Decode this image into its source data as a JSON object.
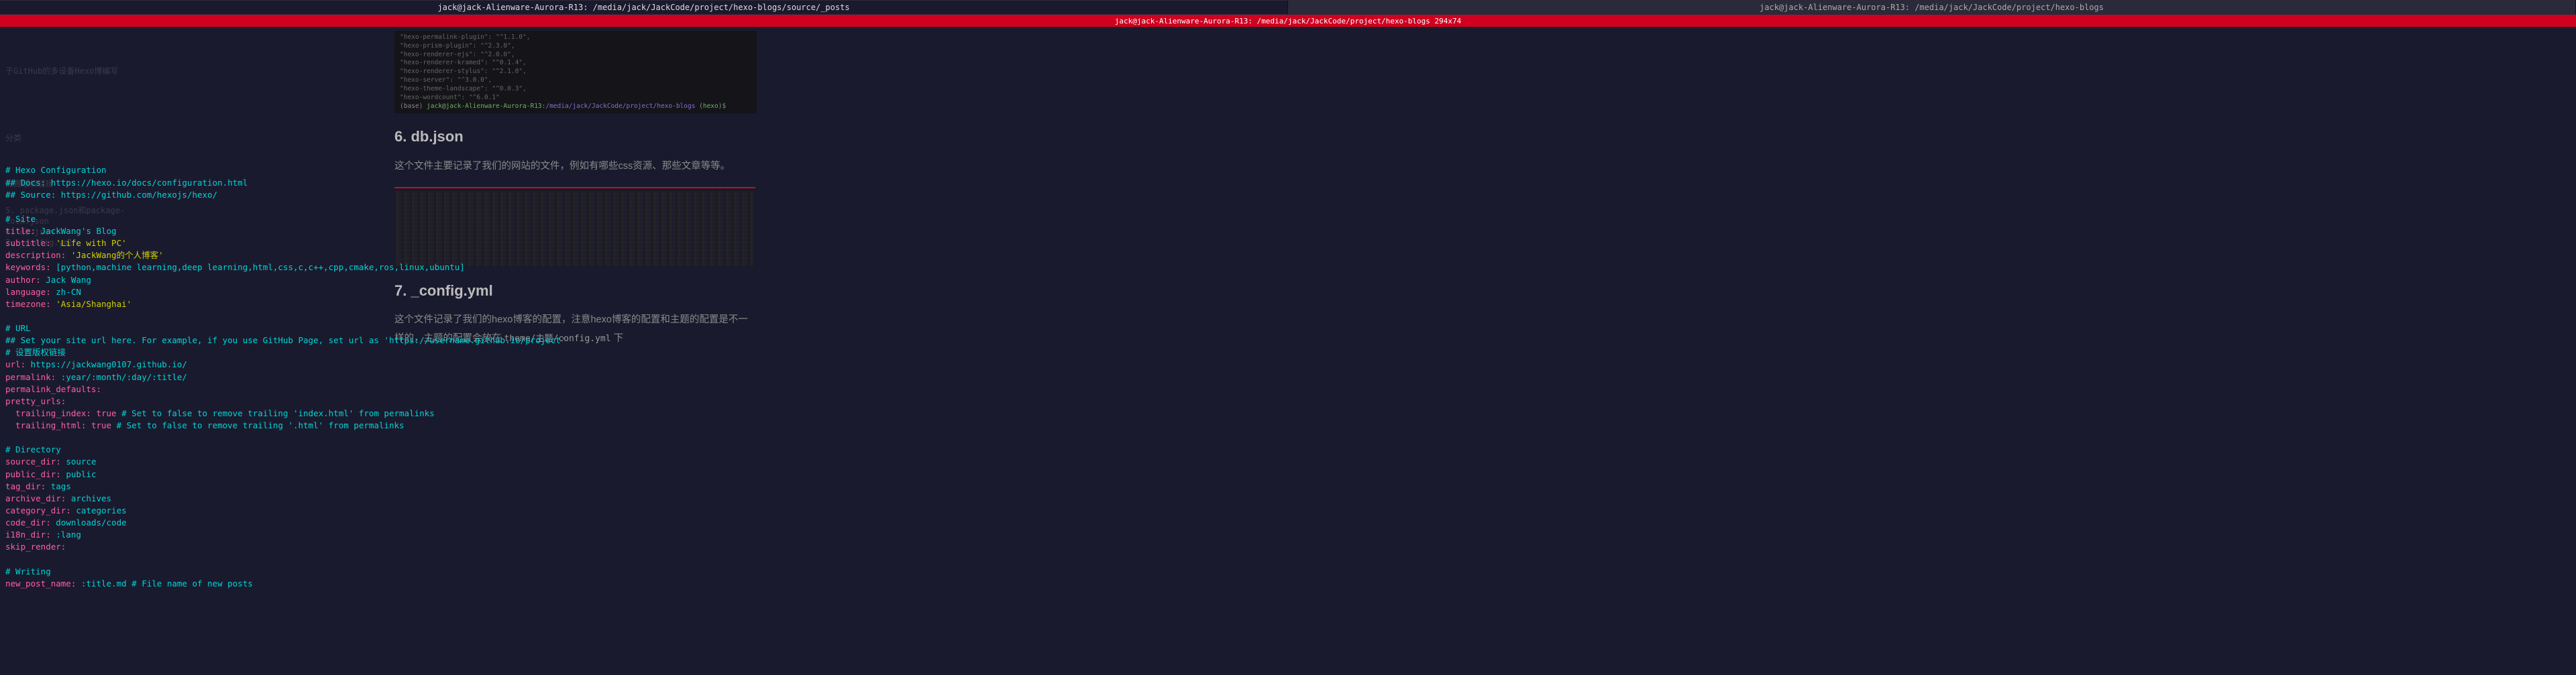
{
  "tabs": {
    "left": "jack@jack-Alienware-Aurora-R13: /media/jack/JackCode/project/hexo-blogs/source/_posts",
    "right": "jack@jack-Alienware-Aurora-R13: /media/jack/JackCode/project/hexo-blogs"
  },
  "subtab": "jack@jack-Alienware-Aurora-R13: /media/jack/JackCode/project/hexo-blogs 294x74",
  "ghost_nav": {
    "g1": "于GitHub的多设备Hexo博编写",
    "g2": "分类",
    "g3": "设置版权链接",
    "g4": "5. package.json和package-",
    "g5": "lock.json",
    "g6": "6. db.json",
    "g7": "7. _config.yml"
  },
  "config": {
    "header_comment": "# Hexo Configuration",
    "docs_comment": "## Docs: https://hexo.io/docs/configuration.html",
    "source_comment": "## Source: https://github.com/hexojs/hexo/",
    "site_comment": "# Site",
    "title_key": "title:",
    "title_val": " JackWang's Blog",
    "subtitle_key": "subtitle:",
    "subtitle_val": " 'Life with PC'",
    "description_key": "description:",
    "description_val": " 'JackWang的个人博客'",
    "keywords_key": "keywords:",
    "keywords_val": " [python,machine learning,deep learning,html,css,c,c++,cpp,cmake,ros,linux,ubuntu]",
    "author_key": "author:",
    "author_val": " Jack Wang",
    "language_key": "language:",
    "language_val": " zh-CN",
    "timezone_key": "timezone:",
    "timezone_val": " 'Asia/Shanghai'",
    "url_comment": "# URL",
    "url_help_comment": "## Set your site url here. For example, if you use GitHub Page, set url as 'https://username.github.io/project'",
    "url_cn_comment": "# 设置版权链接",
    "url_key": "url:",
    "url_val": " https://jackwang0107.github.io/",
    "permalink_key": "permalink:",
    "permalink_val": " :year/:month/:day/:title/",
    "permalink_defaults_key": "permalink_defaults:",
    "pretty_urls_key": "pretty_urls:",
    "trailing_index_key": "  trailing_index:",
    "trailing_index_val": " true",
    "trailing_index_cmt": " # Set to false to remove trailing 'index.html' from permalinks",
    "trailing_html_key": "  trailing_html:",
    "trailing_html_val": " true",
    "trailing_html_cmt": " # Set to false to remove trailing '.html' from permalinks",
    "dir_comment": "# Directory",
    "source_dir_key": "source_dir:",
    "source_dir_val": " source",
    "public_dir_key": "public_dir:",
    "public_dir_val": " public",
    "tag_dir_key": "tag_dir:",
    "tag_dir_val": " tags",
    "archive_dir_key": "archive_dir:",
    "archive_dir_val": " archives",
    "category_dir_key": "category_dir:",
    "category_dir_val": " categories",
    "code_dir_key": "code_dir:",
    "code_dir_val": " downloads/code",
    "i18n_dir_key": "i18n_dir:",
    "i18n_dir_val": " :lang",
    "skip_render_key": "skip_render:",
    "writing_comment": "# Writing",
    "new_post_key": "new_post_name:",
    "new_post_val": " :title.md",
    "new_post_cmt": " # File name of new posts"
  },
  "term": {
    "l1": "\"hexo-permalink-plugin\": \"^1.1.0\",",
    "l2": "\"hexo-prism-plugin\": \"^2.3.0\",",
    "l3": "\"hexo-renderer-ejs\": \"^2.0.0\",",
    "l4": "\"hexo-renderer-kramed\": \"^0.1.4\",",
    "l5": "\"hexo-renderer-stylus\": \"^2.1.0\",",
    "l6": "\"hexo-server\": \"^3.0.0\",",
    "l7": "\"hexo-theme-landscape\": \"^0.0.3\",",
    "l8": "\"hexo-wordcount\": \"^6.0.1\"",
    "prompt_base": "(base)",
    "prompt_user": " jack@jack-Alienware-Aurora-R13",
    "prompt_path": ":/media/jack/JackCode/project/hexo-blogs",
    "prompt_git": "  (hexo)",
    "prompt_cursor": "$"
  },
  "article": {
    "h6": "6. db.json",
    "p6": "这个文件主要记录了我们的网站的文件，例如有哪些css资源、那些文章等等。",
    "h7": "7. _config.yml",
    "p7a": "这个文件记录了我们的hexo博客的配置，注意hexo博客的配置和主题的配置是不一样的，主题的配置会放在 ",
    "p7b": "theme/主题/config.yml",
    "p7c": " 下"
  }
}
